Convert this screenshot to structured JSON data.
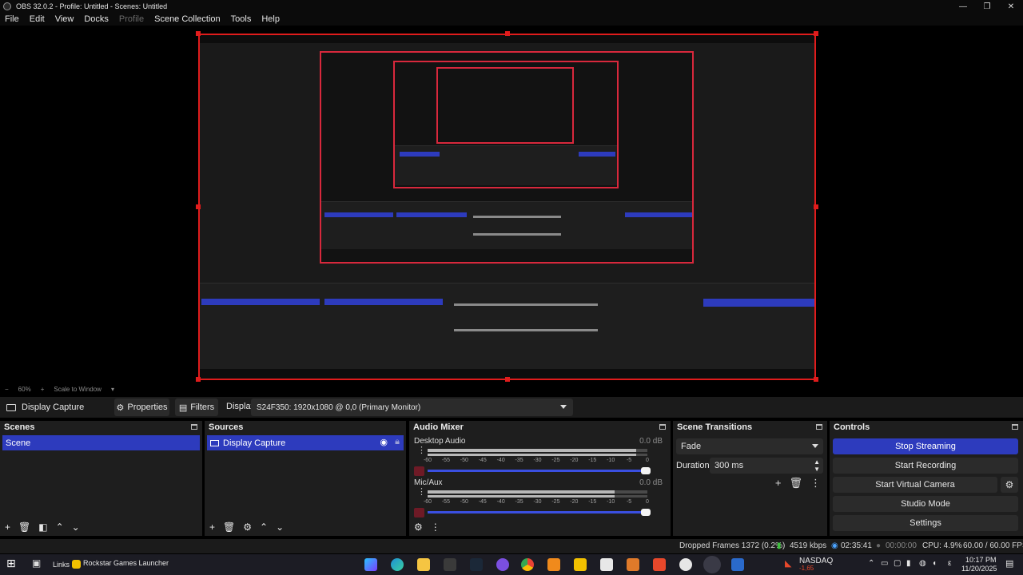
{
  "window": {
    "title": "OBS 32.0.2 - Profile: Untitled - Scenes: Untitled",
    "controls": [
      "—",
      "❐",
      "✕"
    ]
  },
  "menu": [
    "File",
    "Edit",
    "View",
    "Docks",
    "Profile",
    "Scene Collection",
    "Tools",
    "Help"
  ],
  "preview": {
    "zoom": "60%",
    "scale_mode": "Scale to Window"
  },
  "source_toolbar": {
    "source_name": "Display Capture",
    "properties_label": "Properties",
    "filters_label": "Filters",
    "display_label": "Display",
    "display_value": "S24F350: 1920x1080 @ 0,0 (Primary Monitor)"
  },
  "scenes": {
    "title": "Scenes",
    "items": [
      "Scene"
    ]
  },
  "sources": {
    "title": "Sources",
    "items": [
      "Display Capture"
    ]
  },
  "audio_mixer": {
    "title": "Audio Mixer",
    "tracks": [
      {
        "name": "Desktop Audio",
        "db": "0.0 dB",
        "level": 0.95
      },
      {
        "name": "Mic/Aux",
        "db": "0.0 dB",
        "level": 0.85
      }
    ],
    "ticks": [
      "-60",
      "-55",
      "-50",
      "-45",
      "-40",
      "-35",
      "-30",
      "-25",
      "-20",
      "-15",
      "-10",
      "-5",
      "0"
    ]
  },
  "transitions": {
    "title": "Scene Transitions",
    "selected": "Fade",
    "duration_label": "Duration",
    "duration_value": "300 ms"
  },
  "controls": {
    "title": "Controls",
    "stop_streaming": "Stop Streaming",
    "start_recording": "Start Recording",
    "start_virtual_camera": "Start Virtual Camera",
    "studio_mode": "Studio Mode",
    "settings": "Settings"
  },
  "status": {
    "dropped_frames": "Dropped Frames 1372 (0.2%)",
    "bitrate": "4519 kbps",
    "stream_time": "02:35:41",
    "record_time": "00:00:00",
    "cpu": "CPU: 4.9%",
    "fps": "60.00 / 60.00 FPS"
  },
  "taskbar": {
    "links_label": "Links",
    "rockstar_label": "Rockstar Games Launcher",
    "stock_label": "NASDAQ",
    "stock_change": "-1,65",
    "time": "10:17 PM",
    "date": "11/20/2025",
    "ime": "ε"
  },
  "colors": {
    "accent_blue": "#2d3bbd",
    "selection_red": "#e01c1c",
    "dock_bg": "#1e1e1e"
  }
}
